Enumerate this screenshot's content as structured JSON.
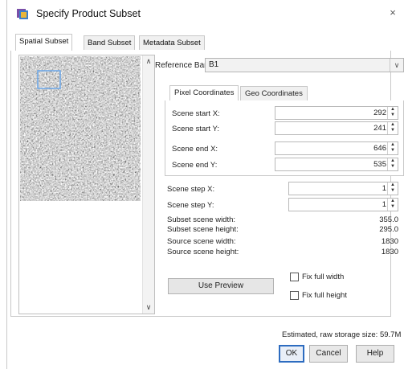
{
  "window": {
    "title": "Specify Product Subset",
    "close_glyph": "×"
  },
  "tabs": [
    {
      "label": "Spatial Subset"
    },
    {
      "label": "Band Subset"
    },
    {
      "label": "Metadata Subset"
    }
  ],
  "reference_band": {
    "label": "Reference Band:",
    "value": "B1"
  },
  "coord_tabs": [
    {
      "label": "Pixel Coordinates"
    },
    {
      "label": "Geo Coordinates"
    }
  ],
  "pixel": {
    "start_x": {
      "label": "Scene start X:",
      "value": "292"
    },
    "start_y": {
      "label": "Scene start Y:",
      "value": "241"
    },
    "end_x": {
      "label": "Scene end X:",
      "value": "646"
    },
    "end_y": {
      "label": "Scene end Y:",
      "value": "535"
    }
  },
  "step": {
    "x": {
      "label": "Scene step X:",
      "value": "1"
    },
    "y": {
      "label": "Scene step Y:",
      "value": "1"
    }
  },
  "info": {
    "subset_width": {
      "label": "Subset scene width:",
      "value": "355.0"
    },
    "subset_height": {
      "label": "Subset scene height:",
      "value": "295.0"
    },
    "source_width": {
      "label": "Source scene width:",
      "value": "1830"
    },
    "source_height": {
      "label": "Source scene height:",
      "value": "1830"
    }
  },
  "use_preview": "Use Preview",
  "fix_full_width": "Fix full width",
  "fix_full_height": "Fix full height",
  "storage": "Estimated, raw storage size: 59.7M",
  "buttons": {
    "ok": "OK",
    "cancel": "Cancel",
    "help": "Help"
  },
  "colors": {
    "accent": "#2d6cc0",
    "selection_box": "#6aa6e8"
  },
  "icons": {
    "app": "product-subset-icon",
    "close": "close-icon",
    "spin": "spinner-arrows-icon"
  }
}
